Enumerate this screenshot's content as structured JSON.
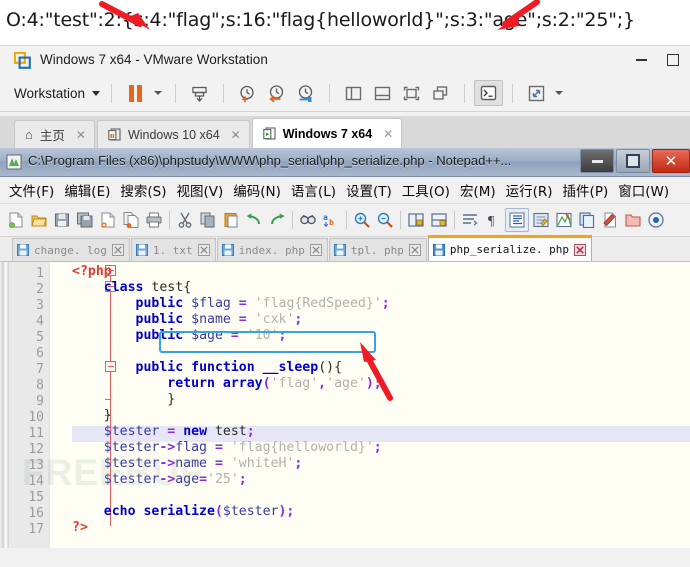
{
  "serialized_output": {
    "text": "O:4:\"test\":2:{s:4:\"flag\";s:16:\"flag{helloworld}\";s:3:\"age\";s:2:\"25\";}"
  },
  "vmware": {
    "title": "Windows 7 x64 - VMware Workstation",
    "window_controls": {
      "minimize": "–",
      "maximize": "□"
    },
    "toolbar": {
      "menu_label": "Workstation",
      "icons": [
        "suspend-icon",
        "send-ctrl-alt-del-icon",
        "take-snapshot-icon",
        "revert-snapshot-icon",
        "snapshot-manager-icon",
        "show-library-icon",
        "show-console-view-icon",
        "show-thumbnails-icon",
        "multiple-windows-icon",
        "console-icon",
        "fullscreen-icon"
      ]
    },
    "tabs": [
      {
        "label": "主页",
        "icon": "home-icon",
        "active": false,
        "close": "✕"
      },
      {
        "label": "Windows 10 x64",
        "icon": "vm-suspended-icon",
        "active": false,
        "close": "✕"
      },
      {
        "label": "Windows 7 x64",
        "icon": "vm-running-icon",
        "active": true,
        "close": "✕"
      }
    ]
  },
  "notepadpp": {
    "title": "C:\\Program Files (x86)\\phpstudy\\WWW\\php_serial\\php_serialize.php - Notepad++...",
    "window_controls": {
      "minimize": "minimize-icon",
      "restore": "restore-icon",
      "close": "✕"
    },
    "menu": [
      "文件(F)",
      "编辑(E)",
      "搜索(S)",
      "视图(V)",
      "编码(N)",
      "语言(L)",
      "设置(T)",
      "工具(O)",
      "宏(M)",
      "运行(R)",
      "插件(P)",
      "窗口(W)"
    ],
    "toolbar_icons": [
      "new-file-icon",
      "open-file-icon",
      "save-icon",
      "save-all-icon",
      "close-file-icon",
      "close-all-icon",
      "print-icon",
      "cut-icon",
      "copy-icon",
      "paste-icon",
      "undo-icon",
      "redo-icon",
      "find-icon",
      "replace-icon",
      "zoom-in-icon",
      "zoom-out-icon",
      "sync-vertical-icon",
      "sync-horizontal-icon",
      "word-wrap-icon",
      "show-all-chars-icon",
      "indent-guide-icon",
      "user-define-dialog-icon",
      "document-map-icon",
      "function-list-icon",
      "document-switcher-icon",
      "macro-record-icon",
      "folder-as-workspace-icon",
      "monitor-icon"
    ],
    "document_tabs": [
      {
        "label": "change. log",
        "active": false
      },
      {
        "label": "1. txt",
        "active": false
      },
      {
        "label": "index. php",
        "active": false
      },
      {
        "label": "tpl. php",
        "active": false
      },
      {
        "label": "php_serialize. php",
        "active": true
      }
    ],
    "editor": {
      "current_line": 11,
      "watermark": "FREEBUF",
      "line_numbers": [
        1,
        2,
        3,
        4,
        5,
        6,
        7,
        8,
        9,
        10,
        11,
        12,
        13,
        14,
        15,
        16,
        17
      ],
      "lines": [
        {
          "n": 1,
          "code": "<?php"
        },
        {
          "n": 2,
          "code": "    class test{"
        },
        {
          "n": 3,
          "code": "        public $flag = 'flag{RedSpeed}';"
        },
        {
          "n": 4,
          "code": "        public $name = 'cxk';"
        },
        {
          "n": 5,
          "code": "        public $age = '10';"
        },
        {
          "n": 6,
          "code": ""
        },
        {
          "n": 7,
          "code": "        public function __sleep(){"
        },
        {
          "n": 8,
          "code": "            return array('flag','age');"
        },
        {
          "n": 9,
          "code": "        }"
        },
        {
          "n": 10,
          "code": "    }"
        },
        {
          "n": 11,
          "code": "    $tester = new test;"
        },
        {
          "n": 12,
          "code": "    $tester->flag = 'flag{helloworld}';"
        },
        {
          "n": 13,
          "code": "    $tester->name = 'whiteH';"
        },
        {
          "n": 14,
          "code": "    $tester->age='25';"
        },
        {
          "n": 15,
          "code": ""
        },
        {
          "n": 16,
          "code": "    echo serialize($tester);"
        },
        {
          "n": 17,
          "code": "?>"
        }
      ]
    }
  },
  "annotations": {
    "highlight_box_line": 4,
    "arrows": [
      {
        "name": "arrow-to-flag-in-output",
        "target": "flag key in serialized output"
      },
      {
        "name": "arrow-to-age-in-output",
        "target": "age key in serialized output"
      },
      {
        "name": "arrow-to-name-property",
        "target": "public $name = 'cxk'; line 4"
      }
    ],
    "accent_color": "#ee1c25",
    "highlight_color": "#3aa0e8"
  }
}
